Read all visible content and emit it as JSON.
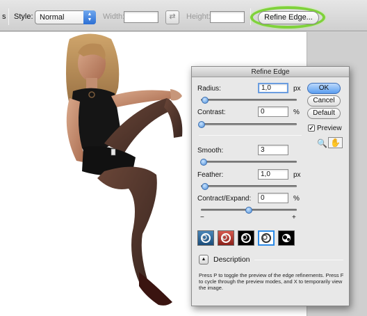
{
  "options_bar": {
    "left_fragment": "s",
    "style_label": "Style:",
    "style_value": "Normal",
    "width_label": "Width:",
    "height_label": "Height:",
    "refine_edge_button": "Refine Edge..."
  },
  "dialog": {
    "title": "Refine Edge",
    "radius": {
      "label": "Radius:",
      "value": "1,0",
      "unit": "px",
      "slider": 0.05
    },
    "contrast": {
      "label": "Contrast:",
      "value": "0",
      "unit": "%",
      "slider": 0.0
    },
    "smooth": {
      "label": "Smooth:",
      "value": "3",
      "slider": 0.03
    },
    "feather": {
      "label": "Feather:",
      "value": "1,0",
      "unit": "px",
      "slider": 0.04
    },
    "contract_expand": {
      "label": "Contract/Expand:",
      "value": "0",
      "unit": "%",
      "slider": 0.5,
      "minus": "−",
      "plus": "+"
    },
    "buttons": {
      "ok": "OK",
      "cancel": "Cancel",
      "default": "Default"
    },
    "preview": {
      "label": "Preview",
      "checked": true
    },
    "tools": [
      "zoom-icon",
      "hand-icon"
    ],
    "view_modes": [
      "standard",
      "quick-mask",
      "on-black",
      "on-white",
      "mask"
    ],
    "selected_view_mode": 3,
    "description_label": "Description",
    "description_text": "Press P to toggle the preview of the edge refinements. Press F to cycle through the preview modes, and X to temporarily view the image."
  },
  "colors": {
    "highlight": "#7fd23a",
    "primary_button": "#5b9ef0",
    "selected_border": "#2c8ae6"
  }
}
